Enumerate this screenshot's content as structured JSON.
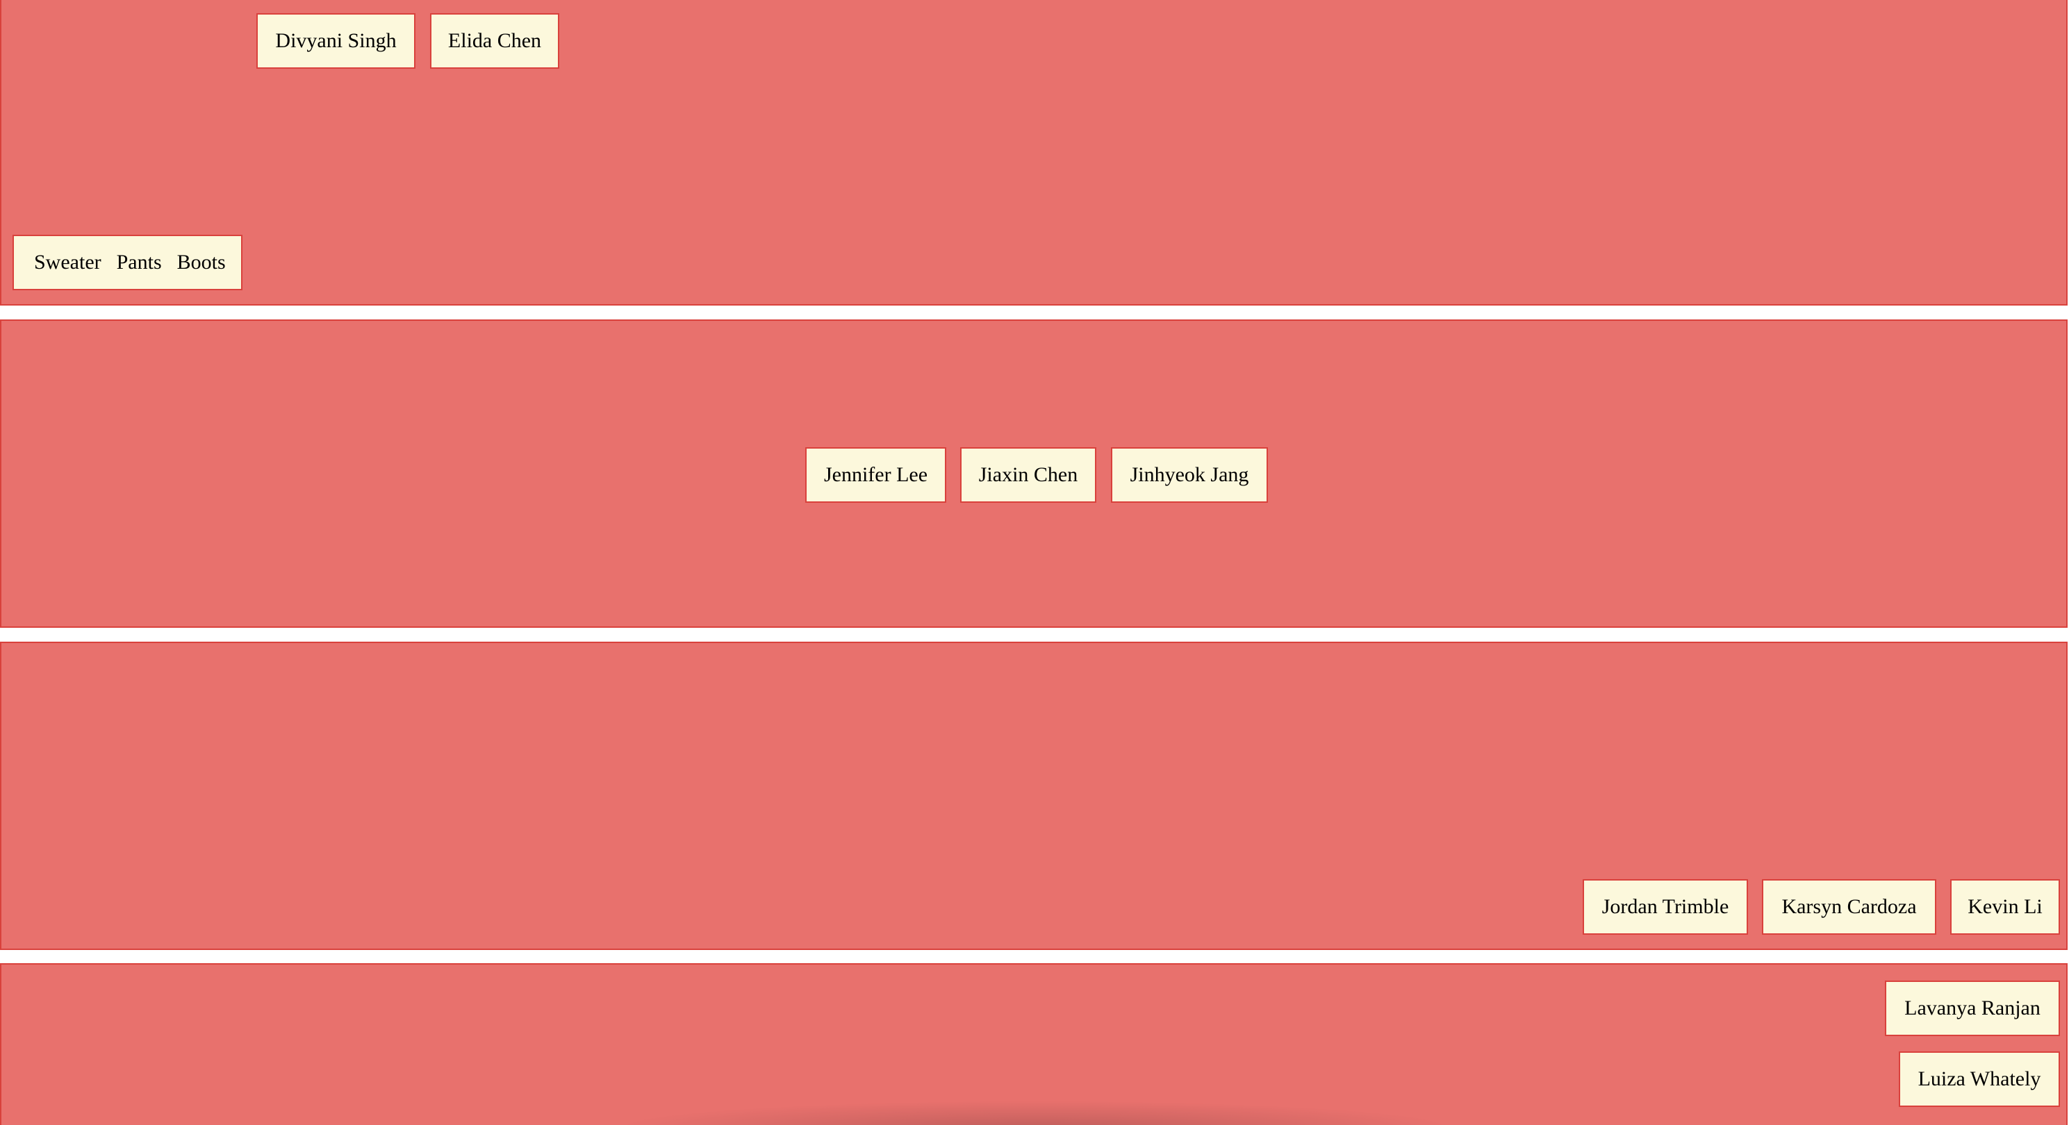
{
  "containers": [
    {
      "items": [
        "Divyani Singh",
        "Elida Chen"
      ],
      "clothing": [
        "Sweater",
        "Pants",
        "Boots"
      ]
    },
    {
      "items": [
        "Jennifer Lee",
        "Jiaxin Chen",
        "Jinhyeok Jang"
      ]
    },
    {
      "items": [
        "Jordan Trimble",
        "Karsyn Cardoza",
        "Kevin Li"
      ]
    },
    {
      "items": [
        "Lavanya Ranjan",
        "Luiza Whately"
      ]
    }
  ],
  "colors": {
    "container_bg": "#e8716d",
    "container_border": "#d9413c",
    "item_bg": "#fcf8dc",
    "page_bg": "#ffffff"
  }
}
